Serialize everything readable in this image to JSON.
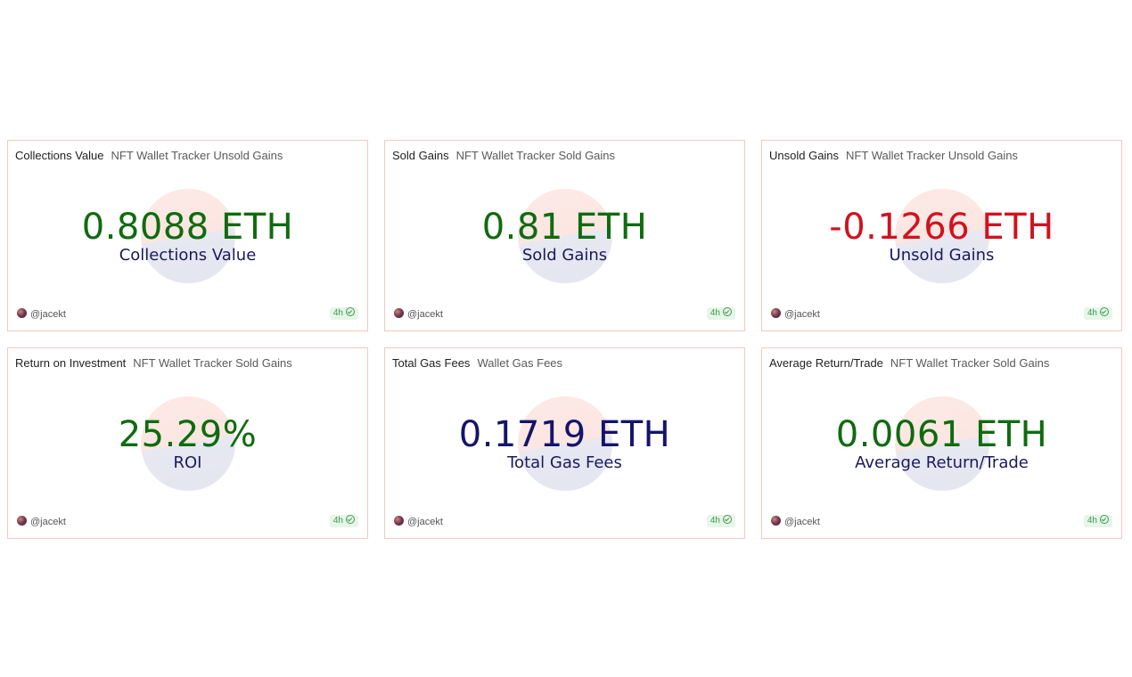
{
  "cards": [
    {
      "title": "Collections Value",
      "subtitle": "NFT Wallet Tracker Unsold Gains",
      "value": "0.8088 ETH",
      "label": "Collections Value",
      "value_color": "green",
      "author": "@jacekt",
      "age": "4h",
      "status_icon": "check-circle-icon"
    },
    {
      "title": "Sold Gains",
      "subtitle": "NFT Wallet Tracker Sold Gains",
      "value": "0.81 ETH",
      "label": "Sold Gains",
      "value_color": "green",
      "author": "@jacekt",
      "age": "4h",
      "status_icon": "check-circle-icon"
    },
    {
      "title": "Unsold Gains",
      "subtitle": "NFT Wallet Tracker Unsold Gains",
      "value": "-0.1266 ETH",
      "label": "Unsold Gains",
      "value_color": "red",
      "author": "@jacekt",
      "age": "4h",
      "status_icon": "check-circle-icon"
    },
    {
      "title": "Return on Investment",
      "subtitle": "NFT Wallet Tracker Sold Gains",
      "value": "25.29%",
      "label": "ROI",
      "value_color": "green",
      "author": "@jacekt",
      "age": "4h",
      "status_icon": "check-circle-icon"
    },
    {
      "title": "Total Gas Fees",
      "subtitle": "Wallet Gas Fees",
      "value": "0.1719 ETH",
      "label": "Total Gas Fees",
      "value_color": "navy",
      "author": "@jacekt",
      "age": "4h",
      "status_icon": "check-circle-icon"
    },
    {
      "title": "Average Return/Trade",
      "subtitle": "NFT Wallet Tracker Sold Gains",
      "value": "0.0061 ETH",
      "label": "Average Return/Trade",
      "value_color": "green",
      "author": "@jacekt",
      "age": "4h",
      "status_icon": "check-circle-icon"
    }
  ],
  "colors": {
    "green": "#0f6b0f",
    "red": "#d1121f",
    "navy": "#14146b",
    "card_border": "#f5c8c3",
    "badge_bg": "#e6f6e8"
  }
}
